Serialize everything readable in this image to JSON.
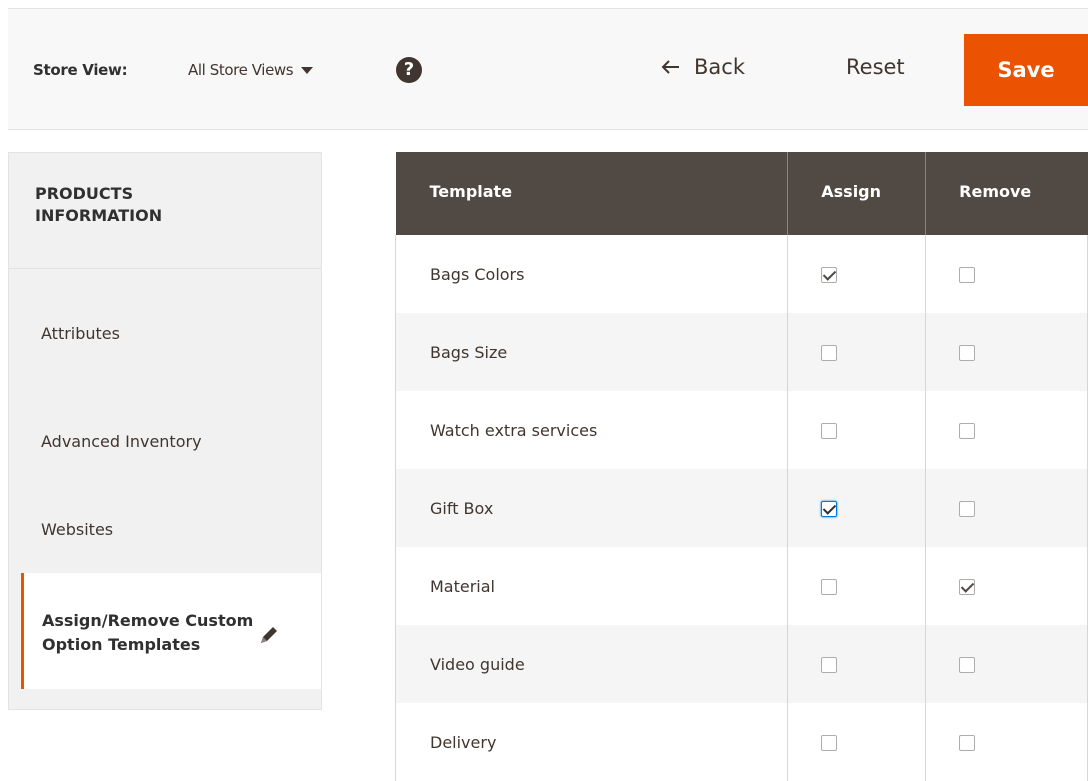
{
  "header": {
    "store_view_label": "Store View:",
    "store_view_value": "All Store Views",
    "help_icon": "question-circle-icon",
    "back_label": "Back",
    "reset_label": "Reset",
    "save_label": "Save",
    "accent_color": "#eb5202"
  },
  "sidebar": {
    "title": "PRODUCTS INFORMATION",
    "items": [
      {
        "label": "Attributes"
      },
      {
        "label": "Advanced Inventory"
      },
      {
        "label": "Websites"
      }
    ],
    "active_item": {
      "label": "Assign/Remove Custom Option Templates",
      "icon": "pencil-icon"
    }
  },
  "table": {
    "headers": [
      "Template",
      "Assign",
      "Remove"
    ],
    "header_color": "#514943",
    "rows": [
      {
        "name": "Bags Colors",
        "assign": true,
        "remove": false
      },
      {
        "name": "Bags Size",
        "assign": false,
        "remove": false
      },
      {
        "name": "Watch extra services",
        "assign": false,
        "remove": false
      },
      {
        "name": "Gift Box",
        "assign": true,
        "remove": false,
        "assign_focused": true
      },
      {
        "name": "Material",
        "assign": false,
        "remove": true
      },
      {
        "name": "Video guide",
        "assign": false,
        "remove": false
      },
      {
        "name": "Delivery",
        "assign": false,
        "remove": false
      }
    ]
  }
}
